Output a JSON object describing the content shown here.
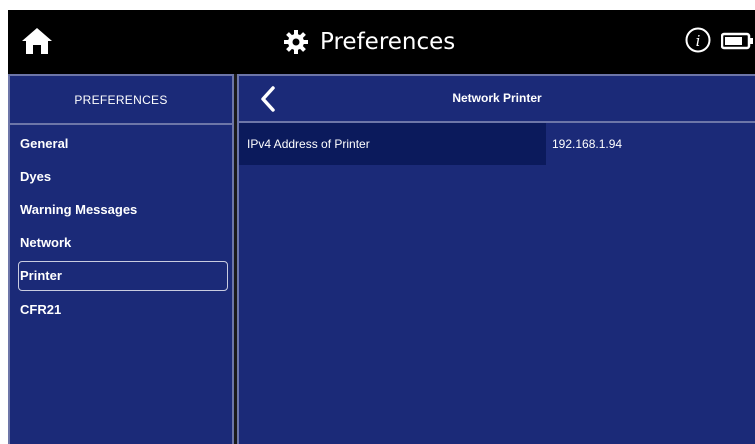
{
  "header": {
    "title": "Preferences",
    "home_icon": "home-icon",
    "gear_icon": "gear-icon",
    "info_icon": "info-icon",
    "battery_icon": "battery-icon"
  },
  "sidebar": {
    "header": "PREFERENCES",
    "items": [
      {
        "label": "General",
        "selected": false
      },
      {
        "label": "Dyes",
        "selected": false
      },
      {
        "label": "Warning Messages",
        "selected": false
      },
      {
        "label": "Network",
        "selected": false
      },
      {
        "label": "Printer",
        "selected": true
      },
      {
        "label": "CFR21",
        "selected": false
      }
    ]
  },
  "main": {
    "back_icon": "chevron-left-icon",
    "title": "Network Printer",
    "settings": [
      {
        "label": "IPv4 Address of Printer",
        "value": "192.168.1.94"
      }
    ]
  },
  "colors": {
    "panel": "#1b2a78",
    "row_dark": "#0b1a5c",
    "topbar": "#000000",
    "border": "#6d76a8"
  }
}
